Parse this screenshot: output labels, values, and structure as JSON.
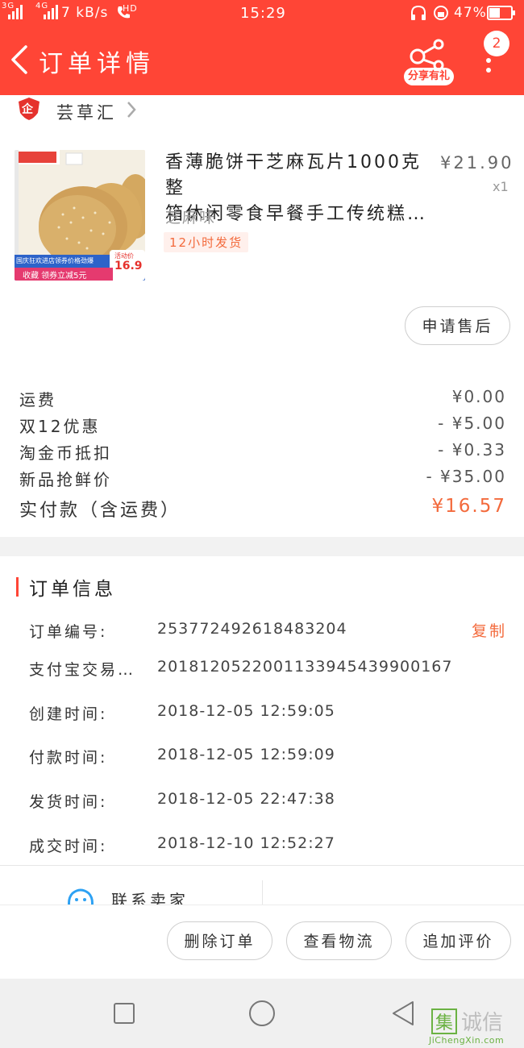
{
  "status_bar": {
    "network_left": "3G",
    "network_right": "4G",
    "speed": "7 kB/s",
    "hd": "HD",
    "time": "15:29",
    "battery": "47%"
  },
  "header": {
    "title": "订单详情",
    "share_label": "分享有礼",
    "message_count": "2"
  },
  "shop": {
    "logo_text": "企",
    "name": "芸草汇"
  },
  "product": {
    "title_line1": "香薄脆饼干芝麻瓦片1000克整",
    "title_line2": "箱休闲零食早餐手工传统糕…",
    "price": "¥21.90",
    "quantity": "x1",
    "sku": "芝麻味",
    "shipping_tag": "12小时发货",
    "thumb_banner": "国庆狂欢进店领券价格劲爆",
    "thumb_badge_label": "活动价",
    "thumb_badge_price": "16.9",
    "thumb_bottom": "收藏  领券立减5元",
    "after_sale_button": "申请售后"
  },
  "fees": [
    {
      "label": "运费",
      "value": "¥0.00"
    },
    {
      "label": "双12优惠",
      "value": "- ¥5.00"
    },
    {
      "label": "淘金币抵扣",
      "value": "- ¥0.33"
    },
    {
      "label": "新品抢鲜价",
      "value": "- ¥35.00"
    }
  ],
  "total": {
    "label": "实付款（含运费）",
    "value": "¥16.57"
  },
  "order_info": {
    "title": "订单信息",
    "copy_label": "复制",
    "rows": [
      {
        "label": "订单编号:",
        "value": "253772492618483204"
      },
      {
        "label": "支付宝交易…",
        "value": "2018120522001133945439900167"
      },
      {
        "label": "创建时间:",
        "value": "2018-12-05 12:59:05"
      },
      {
        "label": "付款时间:",
        "value": "2018-12-05 12:59:09"
      },
      {
        "label": "发货时间:",
        "value": "2018-12-05 22:47:38"
      },
      {
        "label": "成交时间:",
        "value": "2018-12-10 12:52:27"
      }
    ]
  },
  "contact": {
    "label": "联系卖家"
  },
  "actions": {
    "delete": "删除订单",
    "logistics": "查看物流",
    "review": "追加评价"
  },
  "watermark": {
    "brand": "集诚信",
    "url": "JiChengXin.com"
  }
}
